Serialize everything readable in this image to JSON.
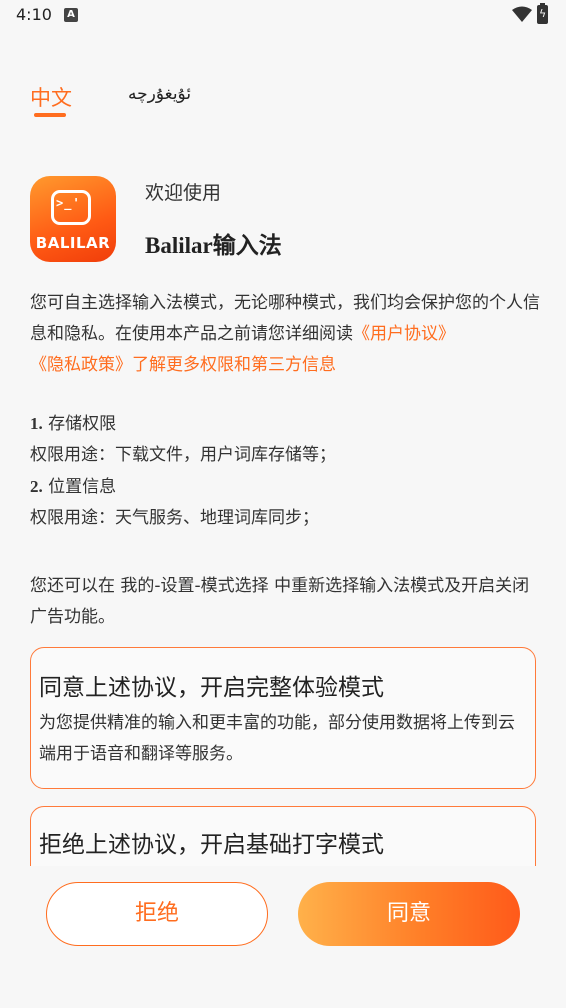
{
  "status": {
    "time": "4:10",
    "notif_badge": "A",
    "battery_glyph": "ϟ"
  },
  "lang": {
    "chinese": "中文",
    "uyghur": "ئۇيغۇرچە"
  },
  "app": {
    "logo_text": "BALILAR",
    "logo_face": ">_'",
    "welcome": "欢迎使用",
    "name": "Balilar输入法"
  },
  "intro": {
    "text_before": "您可自主选择输入法模式，无论哪种模式，我们均会保护您的个人信息和隐私。在使用本产品之前请您详细阅读",
    "user_agreement": "《用户协议》",
    "privacy_policy": "《隐私政策》",
    "text_after": "了解更多权限和第三方信息"
  },
  "permissions": {
    "p1_num": "1",
    "p1_title": "存储权限",
    "p1_use": "权限用途：下载文件，用户词库存储等；",
    "p2_num": "2",
    "p2_title": "位置信息",
    "p2_use": "权限用途：天气服务、地理词库同步；"
  },
  "note": "您还可以在 我的-设置-模式选择 中重新选择输入法模式及开启关闭广告功能。",
  "options": {
    "full_title": "同意上述协议，开启完整体验模式",
    "full_desc": "为您提供精准的输入和更丰富的功能，部分使用数据将上传到云端用于语音和翻译等服务。",
    "basic_title": "拒绝上述协议，开启基础打字模式"
  },
  "buttons": {
    "reject": "拒绝",
    "agree": "同意"
  },
  "colors": {
    "accent": "#ff6d1f"
  }
}
